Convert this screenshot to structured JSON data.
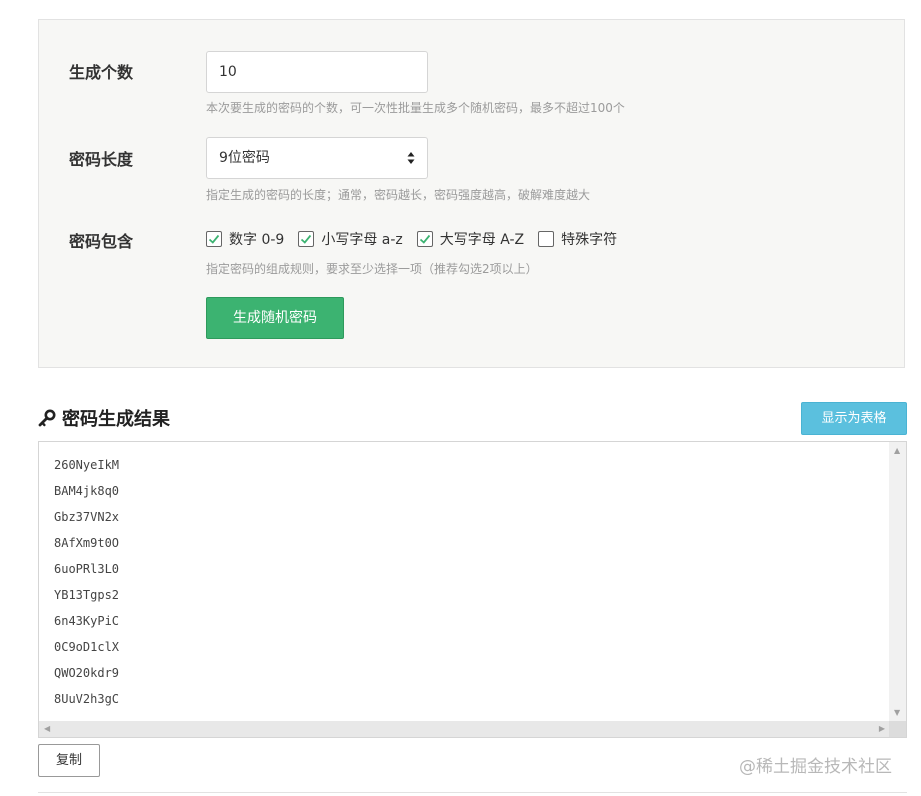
{
  "settings": {
    "count": {
      "label": "生成个数",
      "value": "10",
      "hint": "本次要生成的密码的个数，可一次性批量生成多个随机密码，最多不超过100个"
    },
    "length": {
      "label": "密码长度",
      "value": "9位密码",
      "hint": "指定生成的密码的长度；通常，密码越长，密码强度越高，破解难度越大"
    },
    "include": {
      "label": "密码包含",
      "options": [
        {
          "label": "数字 0-9",
          "checked": true
        },
        {
          "label": "小写字母 a-z",
          "checked": true
        },
        {
          "label": "大写字母 A-Z",
          "checked": true
        },
        {
          "label": "特殊字符",
          "checked": false
        }
      ],
      "hint": "指定密码的组成规则，要求至少选择一项（推荐勾选2项以上）"
    },
    "generate_label": "生成随机密码"
  },
  "result": {
    "title": "密码生成结果",
    "table_button_label": "显示为表格",
    "passwords": [
      "260NyeIkM",
      "BAM4jk8q0",
      "Gbz37VN2x",
      "8AfXm9t0O",
      "6uoPRl3L0",
      "YB13Tgps2",
      "6n43KyPiC",
      "0C9oD1clX",
      "QWO20kdr9",
      "8UuV2h3gC"
    ],
    "copy_label": "复制"
  },
  "watermark": "@稀土掘金技术社区",
  "colors": {
    "accent_green": "#3cb371",
    "accent_blue": "#5bc0de",
    "check_green": "#3cb371"
  }
}
